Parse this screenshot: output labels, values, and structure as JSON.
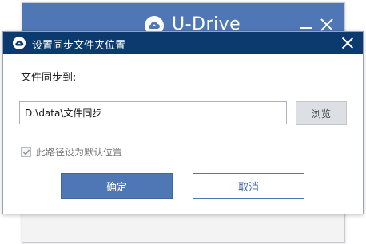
{
  "background_window": {
    "title": "U-Drive",
    "logo_icon": "cloud-sync-icon",
    "minimize_icon": "minimize-icon",
    "close_icon": "close-icon"
  },
  "dialog": {
    "title": "设置同步文件夹位置",
    "icon": "cloud-sync-icon",
    "close_icon": "close-icon",
    "sync_label": "文件同步到:",
    "path_value": "D:\\data\\文件同步",
    "browse_label": "浏览",
    "default_checkbox": {
      "label": "此路径设为默认位置",
      "checked": true,
      "enabled": false
    },
    "ok_label": "确定",
    "cancel_label": "取消"
  },
  "colors": {
    "bg_titlebar": "#4f77b6",
    "dialog_titlebar": "#0c3a6e",
    "primary_button": "#4f76b5",
    "browse_button": "#dcdfe3"
  }
}
